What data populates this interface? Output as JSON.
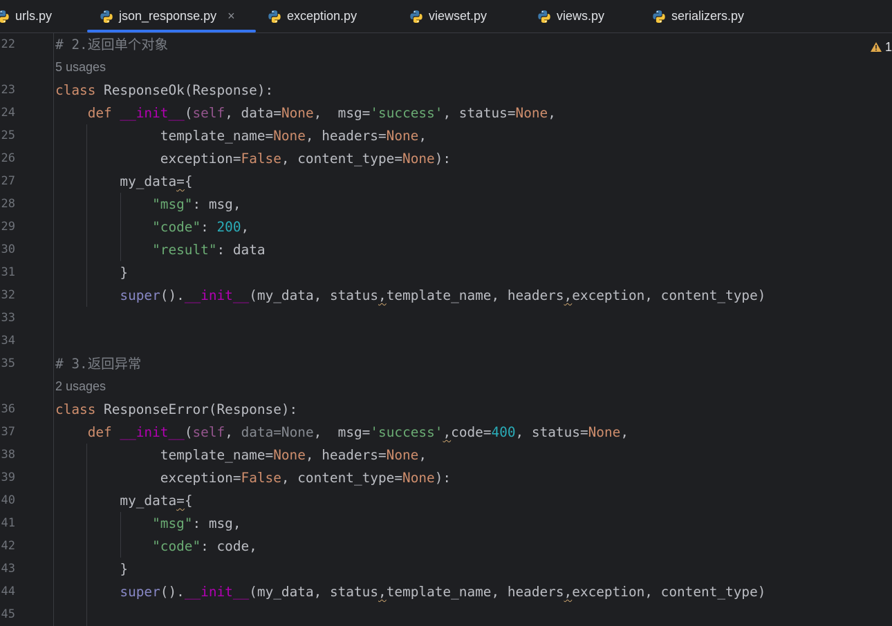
{
  "tabs": [
    {
      "label": "urls.py",
      "active": false
    },
    {
      "label": "json_response.py",
      "active": true
    },
    {
      "label": "exception.py",
      "active": false
    },
    {
      "label": "viewset.py",
      "active": false
    },
    {
      "label": "views.py",
      "active": false
    },
    {
      "label": "serializers.py",
      "active": false
    }
  ],
  "close_glyph": "×",
  "warning_count": "1",
  "colors": {
    "background": "#1e1f22",
    "active_tab_underline": "#3574f0",
    "keyword": "#cf8e6d",
    "string": "#6aab73",
    "number": "#2aacb8",
    "comment": "#7a7e85",
    "dunder": "#b200b2",
    "warning": "#e0a84a"
  },
  "icons": {
    "file_type": "python-file-icon",
    "warning": "warning-triangle-icon"
  },
  "editor": {
    "lines": [
      {
        "n": "22",
        "parts": [
          [
            "cmt",
            "# 2.返回单个对象"
          ]
        ]
      },
      {
        "hint": "5 usages"
      },
      {
        "n": "23",
        "parts": [
          [
            "kw",
            "class "
          ],
          [
            "",
            "ResponseOk(Response):"
          ]
        ]
      },
      {
        "n": "24",
        "parts": [
          [
            "",
            "    "
          ],
          [
            "kw",
            "def "
          ],
          [
            "dunder",
            "__init__"
          ],
          [
            "",
            "("
          ],
          [
            "self",
            "self"
          ],
          [
            "",
            ", data="
          ],
          [
            "kw",
            "None"
          ],
          [
            "",
            ",  msg="
          ],
          [
            "str",
            "'success'"
          ],
          [
            "",
            ", status="
          ],
          [
            "kw",
            "None"
          ],
          [
            "",
            ","
          ]
        ]
      },
      {
        "n": "25",
        "parts": [
          [
            "",
            "             template_name="
          ],
          [
            "kw",
            "None"
          ],
          [
            "",
            ", headers="
          ],
          [
            "kw",
            "None"
          ],
          [
            "",
            ","
          ]
        ]
      },
      {
        "n": "26",
        "parts": [
          [
            "",
            "             exception="
          ],
          [
            "kw",
            "False"
          ],
          [
            "",
            ", content_type="
          ],
          [
            "kw",
            "None"
          ],
          [
            "",
            "):"
          ]
        ]
      },
      {
        "n": "27",
        "parts": [
          [
            "",
            "        my_data"
          ],
          [
            "wavy",
            "="
          ],
          [
            "",
            "{"
          ]
        ]
      },
      {
        "n": "28",
        "parts": [
          [
            "",
            "            "
          ],
          [
            "str",
            "\"msg\""
          ],
          [
            "",
            ": msg,"
          ]
        ]
      },
      {
        "n": "29",
        "parts": [
          [
            "",
            "            "
          ],
          [
            "str",
            "\"code\""
          ],
          [
            "",
            ": "
          ],
          [
            "num",
            "200"
          ],
          [
            "",
            ","
          ]
        ]
      },
      {
        "n": "30",
        "parts": [
          [
            "",
            "            "
          ],
          [
            "str",
            "\"result\""
          ],
          [
            "",
            ": data"
          ]
        ]
      },
      {
        "n": "31",
        "parts": [
          [
            "",
            "        }"
          ]
        ]
      },
      {
        "n": "32",
        "parts": [
          [
            "",
            "        "
          ],
          [
            "sup",
            "super"
          ],
          [
            "",
            "()."
          ],
          [
            "dunder",
            "__init__"
          ],
          [
            "",
            "(my_data, status"
          ],
          [
            "wavy",
            ","
          ],
          [
            "",
            "template_name, headers"
          ],
          [
            "wavy",
            ","
          ],
          [
            "",
            "exception, content_type)"
          ]
        ]
      },
      {
        "n": "33",
        "parts": []
      },
      {
        "n": "34",
        "parts": []
      },
      {
        "n": "35",
        "parts": [
          [
            "cmt",
            "# 3.返回异常"
          ]
        ]
      },
      {
        "hint": "2 usages"
      },
      {
        "n": "36",
        "parts": [
          [
            "kw",
            "class "
          ],
          [
            "",
            "ResponseError(Response):"
          ]
        ]
      },
      {
        "n": "37",
        "parts": [
          [
            "",
            "    "
          ],
          [
            "kw",
            "def "
          ],
          [
            "dunder",
            "__init__"
          ],
          [
            "",
            "("
          ],
          [
            "self",
            "self"
          ],
          [
            "",
            ", "
          ],
          [
            "dim",
            "data=None"
          ],
          [
            "",
            ",  msg="
          ],
          [
            "str",
            "'success'"
          ],
          [
            "wavy",
            ","
          ],
          [
            "",
            "code="
          ],
          [
            "num",
            "400"
          ],
          [
            "",
            ", status="
          ],
          [
            "kw",
            "None"
          ],
          [
            "",
            ","
          ]
        ]
      },
      {
        "n": "38",
        "parts": [
          [
            "",
            "             template_name="
          ],
          [
            "kw",
            "None"
          ],
          [
            "",
            ", headers="
          ],
          [
            "kw",
            "None"
          ],
          [
            "",
            ","
          ]
        ]
      },
      {
        "n": "39",
        "parts": [
          [
            "",
            "             exception="
          ],
          [
            "kw",
            "False"
          ],
          [
            "",
            ", content_type="
          ],
          [
            "kw",
            "None"
          ],
          [
            "",
            "):"
          ]
        ]
      },
      {
        "n": "40",
        "parts": [
          [
            "",
            "        my_data"
          ],
          [
            "wavy",
            "="
          ],
          [
            "",
            "{"
          ]
        ]
      },
      {
        "n": "41",
        "parts": [
          [
            "",
            "            "
          ],
          [
            "str",
            "\"msg\""
          ],
          [
            "",
            ": msg,"
          ]
        ]
      },
      {
        "n": "42",
        "parts": [
          [
            "",
            "            "
          ],
          [
            "str",
            "\"code\""
          ],
          [
            "",
            ": code,"
          ]
        ]
      },
      {
        "n": "43",
        "parts": [
          [
            "",
            "        }"
          ]
        ]
      },
      {
        "n": "44",
        "parts": [
          [
            "",
            "        "
          ],
          [
            "sup",
            "super"
          ],
          [
            "",
            "()."
          ],
          [
            "dunder",
            "__init__"
          ],
          [
            "",
            "(my_data, status"
          ],
          [
            "wavy",
            ","
          ],
          [
            "",
            "template_name, headers"
          ],
          [
            "wavy",
            ","
          ],
          [
            "",
            "exception, content_type)"
          ]
        ]
      },
      {
        "n": "45",
        "parts": []
      }
    ]
  }
}
